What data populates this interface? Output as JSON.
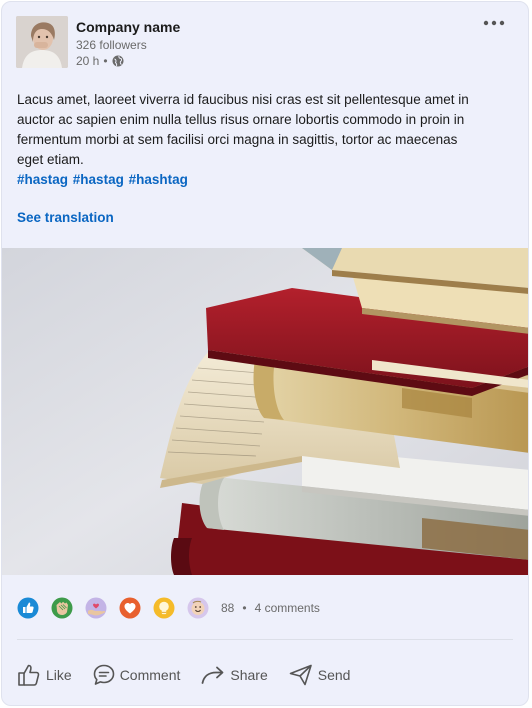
{
  "post": {
    "company_name": "Company name",
    "followers": "326 followers",
    "time": "20 h",
    "separator": "•",
    "text": "Lacus amet, laoreet viverra id faucibus nisi cras est sit pellentesque amet in auctor ac sapien enim nulla tellus risus ornare lobortis commodo in proin in fermentum morbi at sem facilisi orci magna in sagittis, tortor ac maecenas eget etiam.",
    "hashtags": [
      "#hastag",
      "#hastag",
      "#hashtag"
    ],
    "see_translation": "See translation"
  },
  "reactions": {
    "icons": [
      "like-icon",
      "celebrate-icon",
      "support-icon",
      "love-icon",
      "insightful-icon",
      "funny-icon"
    ],
    "count": "88",
    "separator": "•",
    "comments": "4 comments"
  },
  "actions": {
    "like": "Like",
    "comment": "Comment",
    "share": "Share",
    "send": "Send"
  },
  "colors": {
    "card_bg": "#eef0fb",
    "link": "#0a66c2",
    "muted": "#6a6a6a"
  }
}
